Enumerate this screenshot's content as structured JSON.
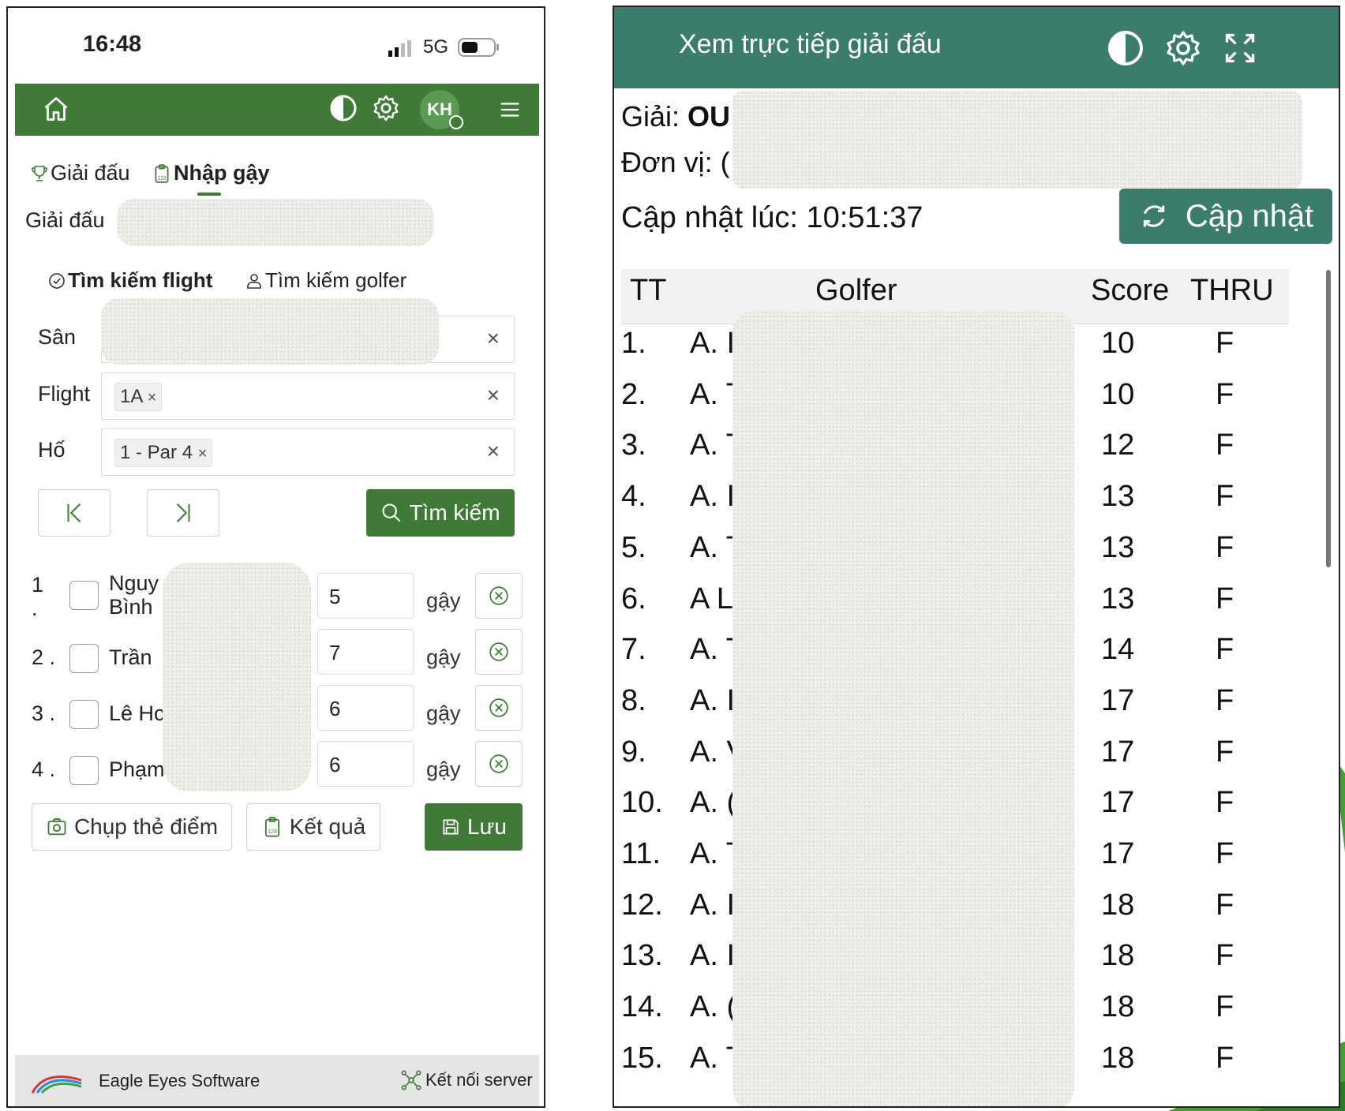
{
  "phone": {
    "status": {
      "time": "16:48",
      "network": "5G"
    },
    "appbar": {
      "avatar": "KH"
    },
    "tabs": [
      {
        "label": "Giải đấu",
        "icon": "trophy-icon"
      },
      {
        "label": "Nhập gậy",
        "icon": "clipboard-icon"
      }
    ],
    "tournament_label": "Giải đấu",
    "search_tabs": [
      {
        "label": "Tìm kiếm flight",
        "icon": "check-circle-icon"
      },
      {
        "label": "Tìm kiếm golfer",
        "icon": "user-icon"
      }
    ],
    "fields": {
      "course_label": "Sân",
      "flight_label": "Flight",
      "flight_value": "1A",
      "hole_label": "Hố",
      "hole_value": "1 - Par 4"
    },
    "search_button": "Tìm kiếm",
    "players": [
      {
        "no": "1",
        "dot": ".",
        "name": "Nguy",
        "name2": "Bình",
        "score": "5",
        "unit": "gậy"
      },
      {
        "no": "2 .",
        "name": "Trần",
        "score": "7",
        "unit": "gậy"
      },
      {
        "no": "3 .",
        "name": "Lê Hc",
        "score": "6",
        "unit": "gậy"
      },
      {
        "no": "4 .",
        "name": "Phạm",
        "score": "6",
        "unit": "gậy"
      }
    ],
    "actions": {
      "scan": "Chụp thẻ điểm",
      "results": "Kết quả",
      "save": "Lưu"
    },
    "footer": {
      "brand": "Eagle Eyes Software",
      "connect": "Kết nối server"
    }
  },
  "live": {
    "title": "Xem trực tiếp giải đấu",
    "tournament_prefix": "Giải:",
    "tournament_value": "OU",
    "unit_prefix": "Đơn vị:",
    "unit_value": "(",
    "updated_label": "Cập nhật lúc: 10:51:37",
    "refresh_button": "Cập nhật",
    "columns": [
      "TT",
      "Golfer",
      "Score",
      "THRU"
    ],
    "rows": [
      {
        "tt": "1.",
        "golfer": "A. I",
        "score": "10",
        "thru": "F"
      },
      {
        "tt": "2.",
        "golfer": "A. T",
        "score": "10",
        "thru": "F"
      },
      {
        "tt": "3.",
        "golfer": "A. T",
        "score": "12",
        "thru": "F"
      },
      {
        "tt": "4.",
        "golfer": "A. I",
        "score": "13",
        "thru": "F"
      },
      {
        "tt": "5.",
        "golfer": "A. T",
        "score": "13",
        "thru": "F"
      },
      {
        "tt": "6.",
        "golfer": "A L",
        "score": "13",
        "thru": "F"
      },
      {
        "tt": "7.",
        "golfer": "A. T",
        "score": "14",
        "thru": "F"
      },
      {
        "tt": "8.",
        "golfer": "A. I",
        "score": "17",
        "thru": "F"
      },
      {
        "tt": "9.",
        "golfer": "A. V",
        "score": "17",
        "thru": "F"
      },
      {
        "tt": "10.",
        "golfer": "A. (",
        "score": "17",
        "thru": "F"
      },
      {
        "tt": "11.",
        "golfer": "A. T",
        "score": "17",
        "thru": "F"
      },
      {
        "tt": "12.",
        "golfer": "A. I",
        "score": "18",
        "thru": "F"
      },
      {
        "tt": "13.",
        "golfer": "A. I",
        "score": "18",
        "thru": "F"
      },
      {
        "tt": "14.",
        "golfer": "A. (",
        "score": "18",
        "thru": "F"
      },
      {
        "tt": "15.",
        "golfer": "A. T",
        "score": "18",
        "thru": "F"
      }
    ]
  },
  "colors": {
    "phone_green": "#3f7b37",
    "live_teal": "#3b7c6c",
    "deco_green": "#4a9a3a"
  }
}
